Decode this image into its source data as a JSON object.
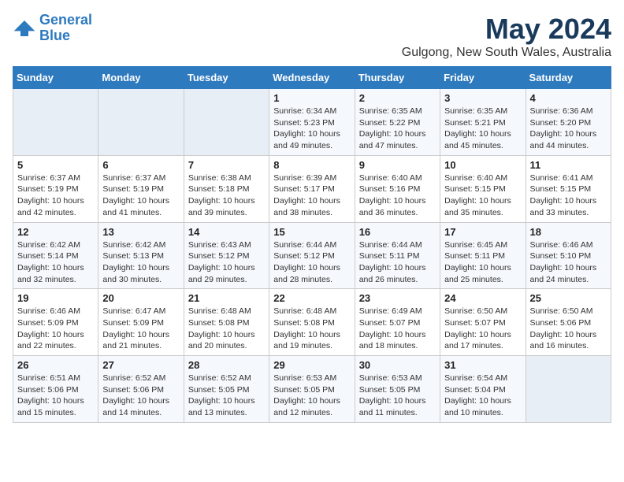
{
  "logo": {
    "line1": "General",
    "line2": "Blue"
  },
  "title": "May 2024",
  "location": "Gulgong, New South Wales, Australia",
  "weekdays": [
    "Sunday",
    "Monday",
    "Tuesday",
    "Wednesday",
    "Thursday",
    "Friday",
    "Saturday"
  ],
  "weeks": [
    [
      {
        "day": "",
        "info": ""
      },
      {
        "day": "",
        "info": ""
      },
      {
        "day": "",
        "info": ""
      },
      {
        "day": "1",
        "info": "Sunrise: 6:34 AM\nSunset: 5:23 PM\nDaylight: 10 hours\nand 49 minutes."
      },
      {
        "day": "2",
        "info": "Sunrise: 6:35 AM\nSunset: 5:22 PM\nDaylight: 10 hours\nand 47 minutes."
      },
      {
        "day": "3",
        "info": "Sunrise: 6:35 AM\nSunset: 5:21 PM\nDaylight: 10 hours\nand 45 minutes."
      },
      {
        "day": "4",
        "info": "Sunrise: 6:36 AM\nSunset: 5:20 PM\nDaylight: 10 hours\nand 44 minutes."
      }
    ],
    [
      {
        "day": "5",
        "info": "Sunrise: 6:37 AM\nSunset: 5:19 PM\nDaylight: 10 hours\nand 42 minutes."
      },
      {
        "day": "6",
        "info": "Sunrise: 6:37 AM\nSunset: 5:19 PM\nDaylight: 10 hours\nand 41 minutes."
      },
      {
        "day": "7",
        "info": "Sunrise: 6:38 AM\nSunset: 5:18 PM\nDaylight: 10 hours\nand 39 minutes."
      },
      {
        "day": "8",
        "info": "Sunrise: 6:39 AM\nSunset: 5:17 PM\nDaylight: 10 hours\nand 38 minutes."
      },
      {
        "day": "9",
        "info": "Sunrise: 6:40 AM\nSunset: 5:16 PM\nDaylight: 10 hours\nand 36 minutes."
      },
      {
        "day": "10",
        "info": "Sunrise: 6:40 AM\nSunset: 5:15 PM\nDaylight: 10 hours\nand 35 minutes."
      },
      {
        "day": "11",
        "info": "Sunrise: 6:41 AM\nSunset: 5:15 PM\nDaylight: 10 hours\nand 33 minutes."
      }
    ],
    [
      {
        "day": "12",
        "info": "Sunrise: 6:42 AM\nSunset: 5:14 PM\nDaylight: 10 hours\nand 32 minutes."
      },
      {
        "day": "13",
        "info": "Sunrise: 6:42 AM\nSunset: 5:13 PM\nDaylight: 10 hours\nand 30 minutes."
      },
      {
        "day": "14",
        "info": "Sunrise: 6:43 AM\nSunset: 5:12 PM\nDaylight: 10 hours\nand 29 minutes."
      },
      {
        "day": "15",
        "info": "Sunrise: 6:44 AM\nSunset: 5:12 PM\nDaylight: 10 hours\nand 28 minutes."
      },
      {
        "day": "16",
        "info": "Sunrise: 6:44 AM\nSunset: 5:11 PM\nDaylight: 10 hours\nand 26 minutes."
      },
      {
        "day": "17",
        "info": "Sunrise: 6:45 AM\nSunset: 5:11 PM\nDaylight: 10 hours\nand 25 minutes."
      },
      {
        "day": "18",
        "info": "Sunrise: 6:46 AM\nSunset: 5:10 PM\nDaylight: 10 hours\nand 24 minutes."
      }
    ],
    [
      {
        "day": "19",
        "info": "Sunrise: 6:46 AM\nSunset: 5:09 PM\nDaylight: 10 hours\nand 22 minutes."
      },
      {
        "day": "20",
        "info": "Sunrise: 6:47 AM\nSunset: 5:09 PM\nDaylight: 10 hours\nand 21 minutes."
      },
      {
        "day": "21",
        "info": "Sunrise: 6:48 AM\nSunset: 5:08 PM\nDaylight: 10 hours\nand 20 minutes."
      },
      {
        "day": "22",
        "info": "Sunrise: 6:48 AM\nSunset: 5:08 PM\nDaylight: 10 hours\nand 19 minutes."
      },
      {
        "day": "23",
        "info": "Sunrise: 6:49 AM\nSunset: 5:07 PM\nDaylight: 10 hours\nand 18 minutes."
      },
      {
        "day": "24",
        "info": "Sunrise: 6:50 AM\nSunset: 5:07 PM\nDaylight: 10 hours\nand 17 minutes."
      },
      {
        "day": "25",
        "info": "Sunrise: 6:50 AM\nSunset: 5:06 PM\nDaylight: 10 hours\nand 16 minutes."
      }
    ],
    [
      {
        "day": "26",
        "info": "Sunrise: 6:51 AM\nSunset: 5:06 PM\nDaylight: 10 hours\nand 15 minutes."
      },
      {
        "day": "27",
        "info": "Sunrise: 6:52 AM\nSunset: 5:06 PM\nDaylight: 10 hours\nand 14 minutes."
      },
      {
        "day": "28",
        "info": "Sunrise: 6:52 AM\nSunset: 5:05 PM\nDaylight: 10 hours\nand 13 minutes."
      },
      {
        "day": "29",
        "info": "Sunrise: 6:53 AM\nSunset: 5:05 PM\nDaylight: 10 hours\nand 12 minutes."
      },
      {
        "day": "30",
        "info": "Sunrise: 6:53 AM\nSunset: 5:05 PM\nDaylight: 10 hours\nand 11 minutes."
      },
      {
        "day": "31",
        "info": "Sunrise: 6:54 AM\nSunset: 5:04 PM\nDaylight: 10 hours\nand 10 minutes."
      },
      {
        "day": "",
        "info": ""
      }
    ]
  ]
}
